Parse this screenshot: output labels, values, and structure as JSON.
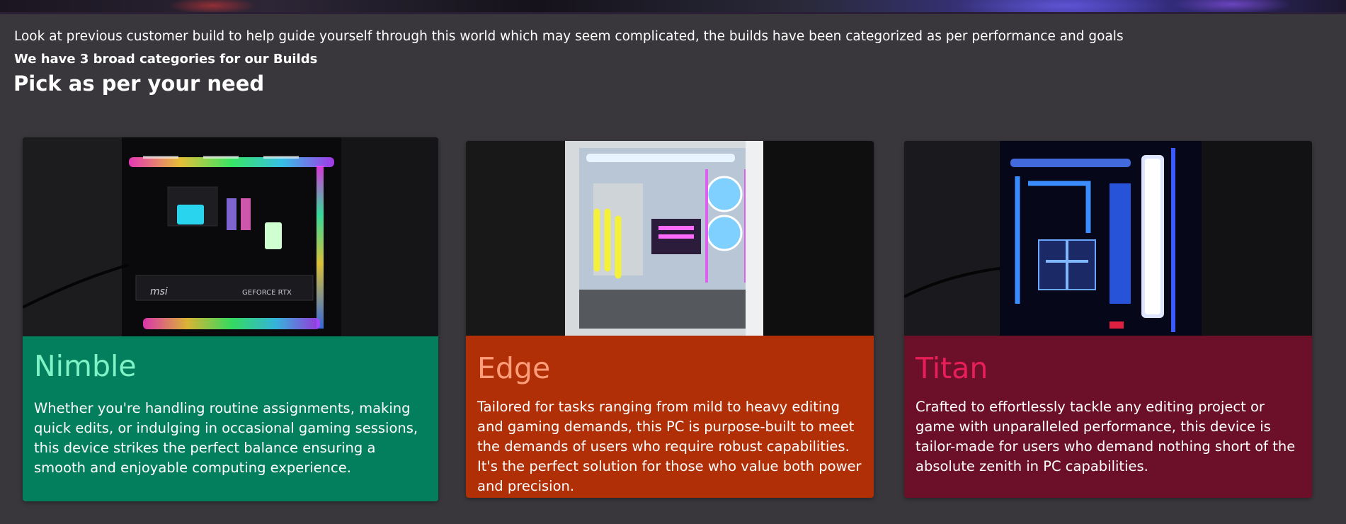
{
  "intro": {
    "text": "Look at previous customer build to help guide yourself through this world which may seem complicated, the builds have been categorized as per performance and goals",
    "subtext": "We have 3 broad categories for our Builds",
    "heading": "Pick as per your need"
  },
  "cards": [
    {
      "title": "Nimble",
      "description": "Whether you're handling routine assignments, making quick edits, or indulging in occasional gaming sessions, this device strikes the perfect balance ensuring a smooth and enjoyable computing experience.",
      "image_alt": "PC build with RGB lighting and MSI GeForce RTX graphics card",
      "gpu_label": "msi",
      "gpu_label_2": "GEFORCE RTX",
      "accent_color": "#047f5e",
      "title_color": "#7ff2c6"
    },
    {
      "title": "Edge",
      "description": "Tailored for tasks ranging from mild to heavy editing and gaming demands, this PC is purpose-built to meet the demands of users who require robust capabilities. It's the perfect solution for those who value both power and precision.",
      "image_alt": "White PC case with liquid cooling loop and fans",
      "accent_color": "#b02f06",
      "title_color": "#ff9c79"
    },
    {
      "title": "Titan",
      "description": "Crafted to effortlessly tackle any editing project or game with unparalleled performance, this device is tailor-made for users who demand nothing short of the absolute zenith in PC capabilities.",
      "image_alt": "Black PC case with blue liquid cooling",
      "accent_color": "#6c1029",
      "title_color": "#e81e59"
    }
  ]
}
